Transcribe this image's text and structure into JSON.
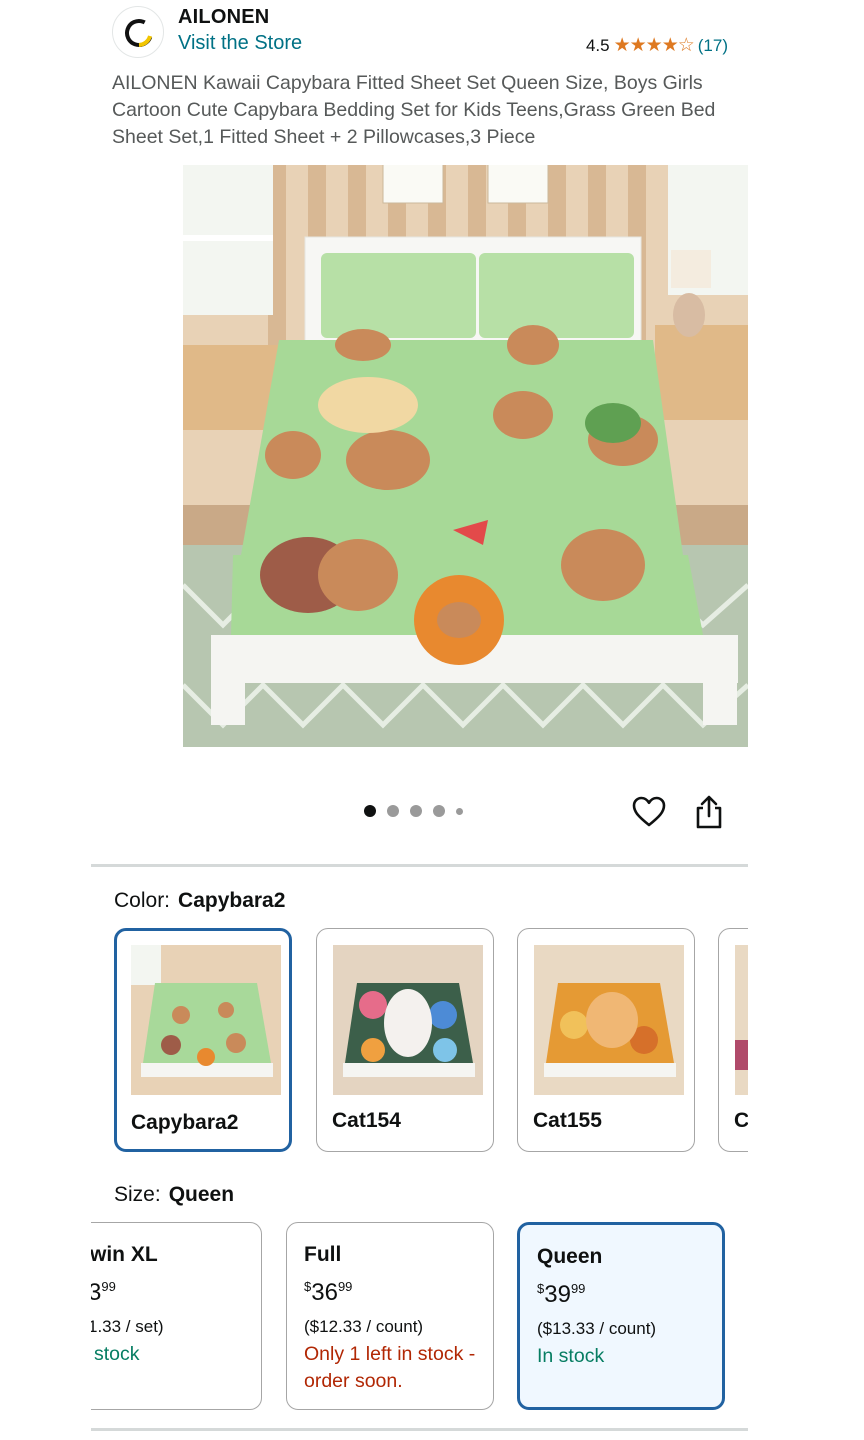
{
  "header": {
    "brand_name": "AILONEN",
    "store_link": "Visit the Store",
    "rating_value": "4.5",
    "rating_stars": "★★★★☆",
    "rating_count": "(17)"
  },
  "product": {
    "title": "AILONEN Kawaii Capybara Fitted Sheet Set Queen Size, Boys Girls Cartoon Cute Capybara Bedding Set for Kids Teens,Grass Green Bed Sheet Set,1 Fitted Sheet + 2 Pillowcases,3 Piece"
  },
  "gallery": {
    "dot_count": 5,
    "active_index": 0
  },
  "color": {
    "label": "Color:",
    "selected": "Capybara2",
    "options": [
      {
        "label": "Capybara2",
        "palette": "#a8d99a"
      },
      {
        "label": "Cat154",
        "palette": "#3c5f4a"
      },
      {
        "label": "Cat155",
        "palette": "#e59a34"
      },
      {
        "label": "C",
        "palette": "#b04a6a"
      }
    ]
  },
  "size": {
    "label": "Size:",
    "selected": "Queen",
    "options": [
      {
        "name": "win XL",
        "price_whole": "3",
        "price_cents": "99",
        "unit": "1.33 / set)",
        "stock": "stock",
        "stock_type": "in"
      },
      {
        "name": "Full",
        "price_currency": "$",
        "price_whole": "36",
        "price_cents": "99",
        "unit": "($12.33 / count)",
        "stock": "Only 1 left in stock - order soon.",
        "stock_type": "low"
      },
      {
        "name": "Queen",
        "price_currency": "$",
        "price_whole": "39",
        "price_cents": "99",
        "unit": "($13.33 / count)",
        "stock": "In stock",
        "stock_type": "in"
      }
    ]
  },
  "colors": {
    "link": "#007185",
    "star": "#de7921",
    "selected_border": "#2162a1",
    "in_stock": "#067d62",
    "low_stock": "#b12704"
  }
}
